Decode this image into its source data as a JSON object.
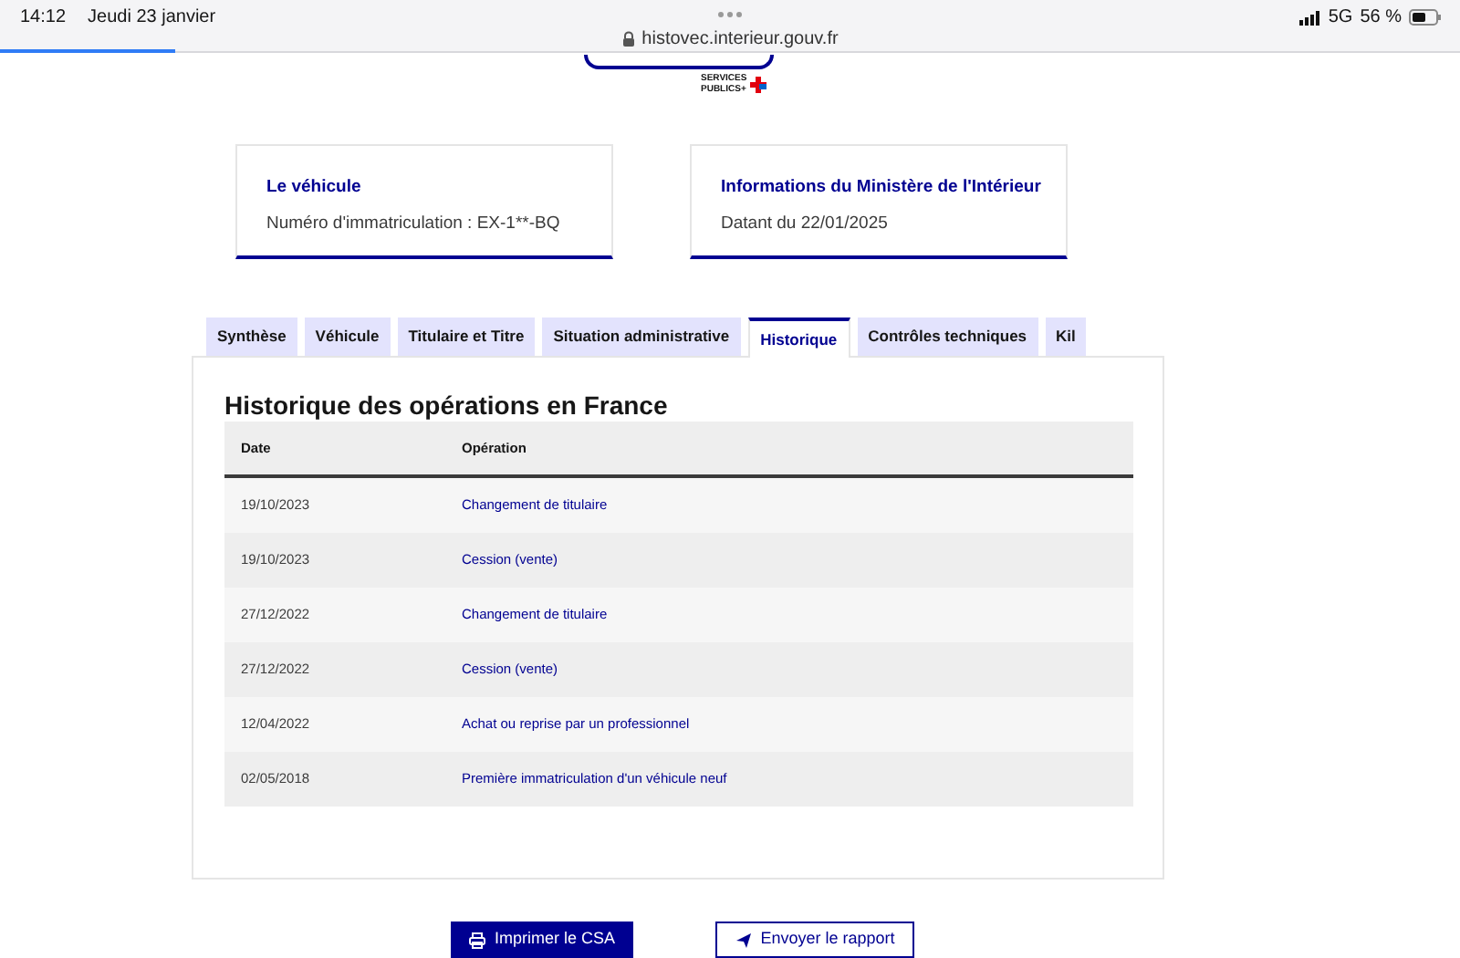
{
  "status_bar": {
    "time": "14:12",
    "date": "Jeudi 23 janvier",
    "network": "5G",
    "battery": "56 %",
    "url": "histovec.interieur.gouv.fr",
    "load_progress": {
      "level": 0.12
    }
  },
  "logo": {
    "line_1": "SERVICES",
    "line_2": "PUBLICS+"
  },
  "cards": [
    {
      "title": "Le véhicule",
      "text": "Numéro d'immatriculation : EX-1**-BQ"
    },
    {
      "title": "Informations du Ministère de l'Intérieur",
      "text": "Datant du 22/01/2025"
    }
  ],
  "tabs": [
    {
      "label": "Synthèse",
      "selected": false
    },
    {
      "label": "Véhicule",
      "selected": false
    },
    {
      "label": "Titulaire et Titre",
      "selected": false
    },
    {
      "label": "Situation administrative",
      "selected": false
    },
    {
      "label": "Historique",
      "selected": true
    },
    {
      "label": "Contrôles techniques",
      "selected": false
    },
    {
      "label": "Kil",
      "selected": false
    }
  ],
  "panel": {
    "title": "Historique des opérations en France",
    "table": {
      "columns": [
        "Date",
        "Opération"
      ],
      "rows": [
        [
          "19/10/2023",
          "Changement de titulaire"
        ],
        [
          "19/10/2023",
          "Cession (vente)"
        ],
        [
          "27/12/2022",
          "Changement de titulaire"
        ],
        [
          "27/12/2022",
          "Cession (vente)"
        ],
        [
          "12/04/2022",
          "Achat ou reprise par un professionnel"
        ],
        [
          "02/05/2018",
          "Première immatriculation d'un véhicule neuf"
        ]
      ]
    }
  },
  "buttons": [
    {
      "label": "Imprimer le CSA",
      "kind": "primary"
    },
    {
      "label": "Envoyer le rapport",
      "kind": "secondary"
    }
  ]
}
